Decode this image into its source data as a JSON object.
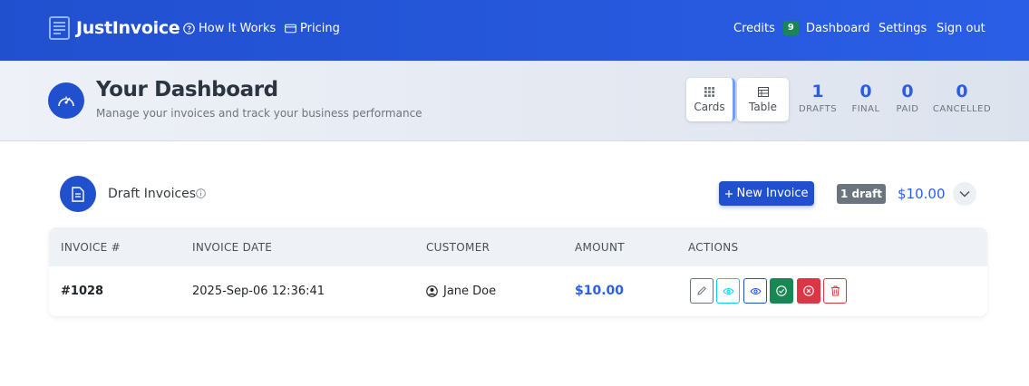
{
  "nav": {
    "brand": "JustInvoice",
    "how_it_works": "How It Works",
    "pricing": "Pricing",
    "credits_label": "Credits",
    "credits_count": "9",
    "dashboard": "Dashboard",
    "settings": "Settings",
    "sign_out": "Sign out"
  },
  "header": {
    "title": "Your Dashboard",
    "subtitle": "Manage your invoices and track your business performance",
    "view_cards": "Cards",
    "view_table": "Table",
    "stats": [
      {
        "value": "1",
        "label": "DRAFTS"
      },
      {
        "value": "0",
        "label": "FINAL"
      },
      {
        "value": "0",
        "label": "PAID"
      },
      {
        "value": "0",
        "label": "CANCELLED"
      }
    ]
  },
  "drafts": {
    "title": "Draft Invoices",
    "new_invoice": "New Invoice",
    "badge": "1 draft",
    "total": "$10.00",
    "columns": [
      "INVOICE #",
      "INVOICE DATE",
      "CUSTOMER",
      "AMOUNT",
      "ACTIONS"
    ],
    "rows": [
      {
        "number": "#1028",
        "date": "2025-Sep-06 12:36:41",
        "customer": "Jane Doe",
        "amount": "$10.00"
      }
    ]
  },
  "colors": {
    "primary": "#2150cf",
    "accent_text": "#2a5ee6",
    "success": "#198754",
    "danger": "#dc3545",
    "info": "#0dcaf0",
    "secondary": "#6c757d"
  },
  "icons": [
    "invoice-logo-icon",
    "question-circle-icon",
    "credit-card-icon",
    "speedometer-icon",
    "grid-icon",
    "table-icon",
    "document-icon",
    "info-icon",
    "plus-icon",
    "chevron-down-icon",
    "person-circle-icon",
    "pencil-icon",
    "eye-icon",
    "check-circle-icon",
    "x-circle-icon",
    "trash-icon"
  ]
}
